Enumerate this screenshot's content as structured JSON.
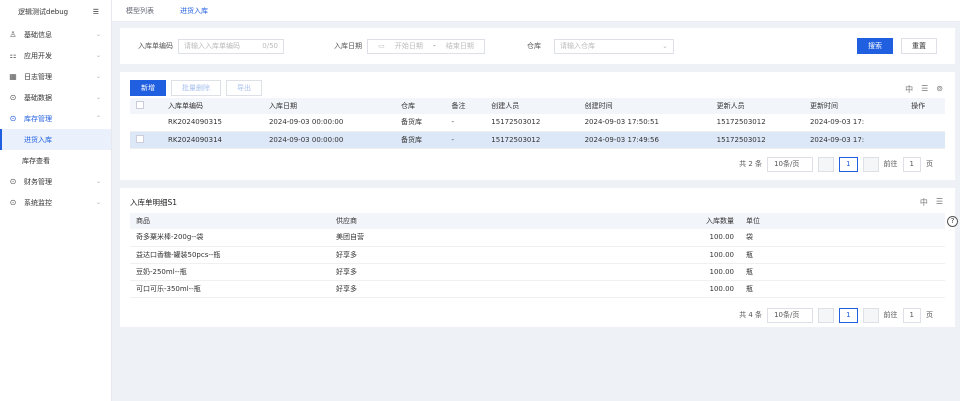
{
  "sidebar": {
    "title": "逻辑测试debug",
    "items": [
      {
        "label": "基础信息",
        "icon": "user-icon"
      },
      {
        "label": "应用开发",
        "icon": "app-icon"
      },
      {
        "label": "日志管理",
        "icon": "calendar-icon"
      },
      {
        "label": "基础数据",
        "icon": "database-icon"
      },
      {
        "label": "库存管理",
        "icon": "inventory-icon",
        "sub": [
          "进货入库",
          "库存查看"
        ]
      },
      {
        "label": "财务管理",
        "icon": "finance-icon"
      },
      {
        "label": "系统监控",
        "icon": "monitor-icon"
      }
    ]
  },
  "tabs": [
    "模型列表",
    "进货入库"
  ],
  "search": {
    "code_label": "入库单编码",
    "code_placeholder": "请输入入库单编码",
    "code_count": "0/50",
    "date_label": "入库日期",
    "date_start": "开始日期",
    "date_sep": "-",
    "date_end": "结束日期",
    "wh_label": "仓库",
    "wh_placeholder": "请输入仓库",
    "search_btn": "搜索",
    "reset_btn": "重置"
  },
  "toolbar": {
    "add": "新增",
    "batch_delete": "批量删除",
    "export": "导出"
  },
  "main_table": {
    "columns": [
      "入库单编码",
      "入库日期",
      "仓库",
      "备注",
      "创建人员",
      "创建时间",
      "更新人员",
      "更新时间",
      "操作"
    ],
    "rows": [
      [
        "RK2024090315",
        "2024-09-03 00:00:00",
        "备货库",
        "-",
        "15172503012",
        "2024-09-03 17:50:51",
        "15172503012",
        "2024-09-03 17:"
      ],
      [
        "RK2024090314",
        "2024-09-03 00:00:00",
        "备货库",
        "-",
        "15172503012",
        "2024-09-03 17:49:56",
        "15172503012",
        "2024-09-03 17:"
      ]
    ]
  },
  "pager1": {
    "total": "共 2 条",
    "size": "10条/页",
    "page": "1",
    "goto": "前往",
    "goto_val": "1",
    "unit": "页"
  },
  "detail": {
    "title": "入库单明细S1",
    "columns": [
      "商品",
      "供应商",
      "入库数量",
      "单位"
    ],
    "rows": [
      [
        "奇多粟米棒-200g--袋",
        "美团自营",
        "100.00",
        "袋"
      ],
      [
        "益达口香糖-罐装50pcs--瓶",
        "好享多",
        "100.00",
        "瓶"
      ],
      [
        "豆奶-250ml--瓶",
        "好享多",
        "100.00",
        "瓶"
      ],
      [
        "可口可乐-350ml--瓶",
        "好享多",
        "100.00",
        "瓶"
      ]
    ]
  },
  "pager2": {
    "total": "共 4 条",
    "size": "10条/页",
    "page": "1",
    "goto": "前往",
    "goto_val": "1",
    "unit": "页"
  },
  "colors": {
    "primary": "#1f5fe0",
    "selected_row": "#dce8f8"
  }
}
